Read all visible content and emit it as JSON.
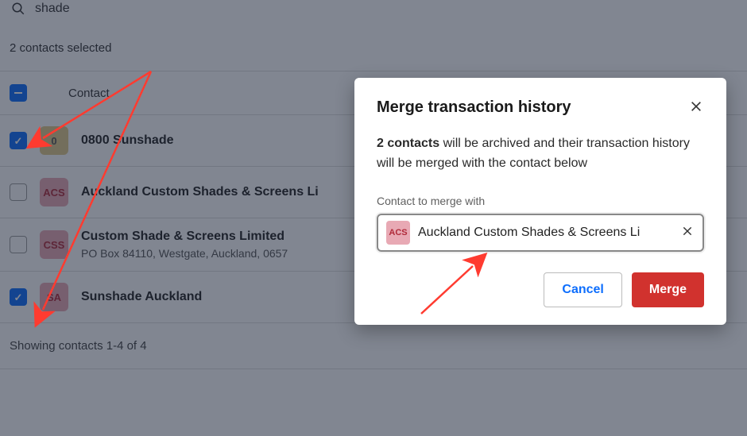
{
  "search": {
    "value": "shade"
  },
  "selection_summary": "2 contacts selected",
  "header": {
    "column_label": "Contact"
  },
  "rows": [
    {
      "avatar_text": "0",
      "avatar_class": "zero",
      "name": "0800 Sunshade",
      "sub": "",
      "checked": true
    },
    {
      "avatar_text": "ACS",
      "avatar_class": "acs",
      "name": "Auckland Custom Shades & Screens Li",
      "sub": "",
      "checked": false
    },
    {
      "avatar_text": "CSS",
      "avatar_class": "css",
      "name": "Custom Shade & Screens Limited",
      "sub": "PO Box 84110, Westgate, Auckland, 0657",
      "checked": false
    },
    {
      "avatar_text": "SA",
      "avatar_class": "sa",
      "name": "Sunshade Auckland",
      "sub": "",
      "checked": true
    }
  ],
  "footer": "Showing contacts 1-4 of 4",
  "modal": {
    "title": "Merge transaction history",
    "desc_bold": "2 contacts",
    "desc_rest": " will be archived and their transaction history will be merged with the contact below",
    "field_label": "Contact to merge with",
    "merge_avatar": "ACS",
    "merge_name": "Auckland Custom Shades & Screens Li",
    "cancel": "Cancel",
    "merge": "Merge"
  }
}
